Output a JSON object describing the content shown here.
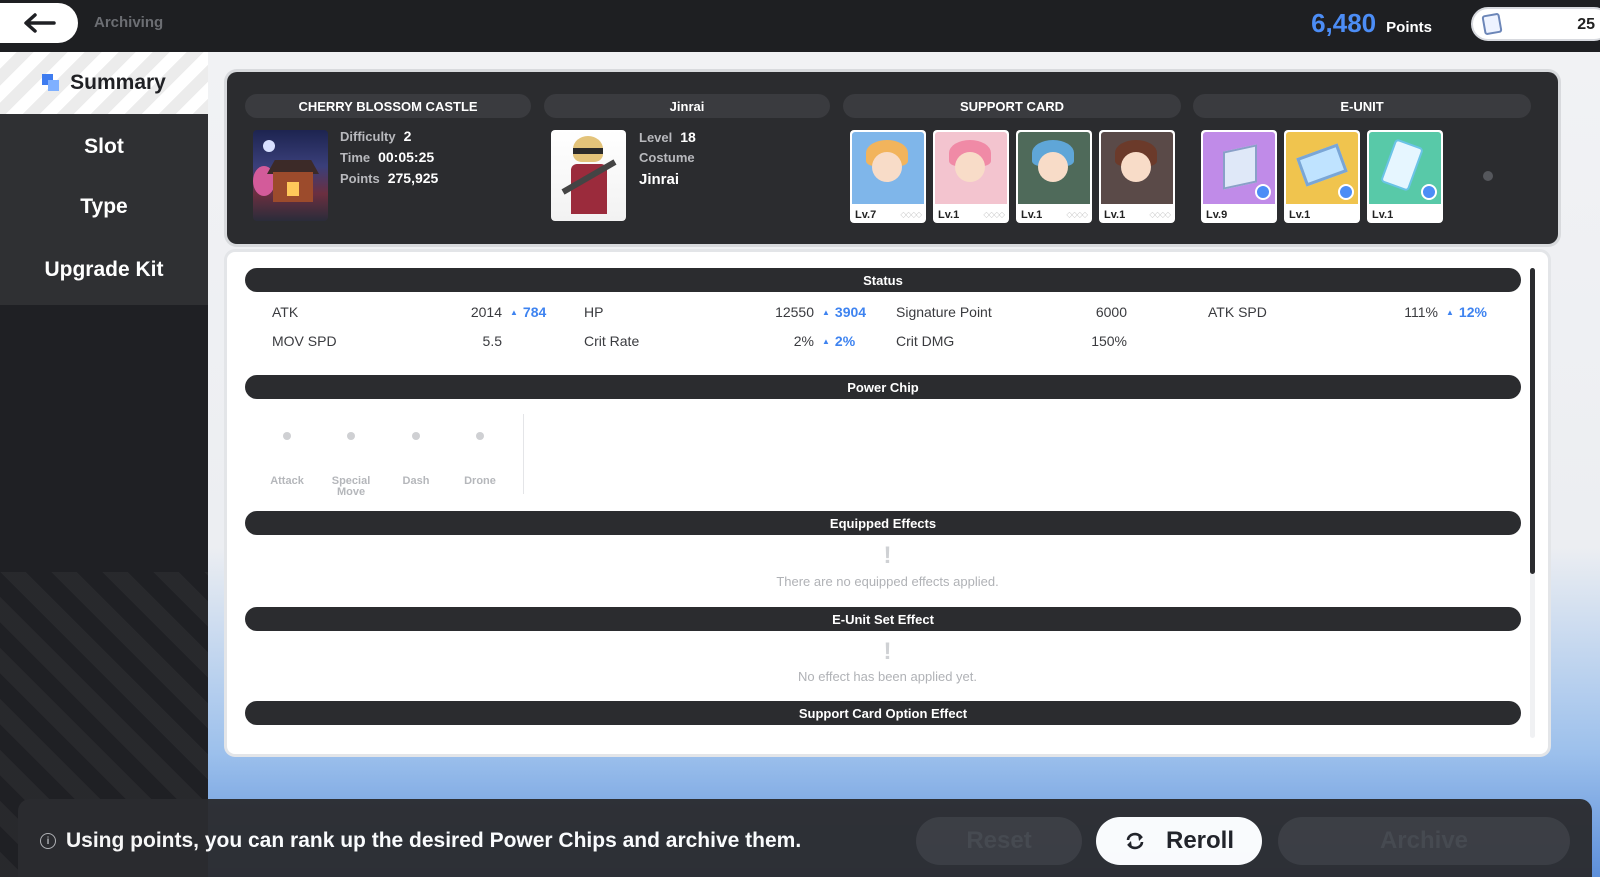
{
  "topbar": {
    "breadcrumb": "Archiving",
    "points_value": "6,480",
    "points_label": "Points",
    "currency_value": "25"
  },
  "nav": {
    "summary": "Summary",
    "slot": "Slot",
    "type": "Type",
    "upgrade_kit": "Upgrade Kit"
  },
  "header": {
    "stage_tag": "CHERRY BLOSSOM CASTLE",
    "difficulty_label": "Difficulty",
    "difficulty": "2",
    "time_label": "Time",
    "time": "00:05:25",
    "points_label": "Points",
    "points": "275,925",
    "char_tag": "Jinrai",
    "level_label": "Level",
    "level": "18",
    "costume_label": "Costume",
    "costume": "Jinrai",
    "support_tag": "SUPPORT CARD",
    "eunit_tag": "E-UNIT",
    "support_cards": [
      {
        "level": "Lv.7",
        "hair": "#f2b45c",
        "bg": "#7fb6ea"
      },
      {
        "level": "Lv.1",
        "hair": "#f08aa6",
        "bg": "#f3c4cf"
      },
      {
        "level": "Lv.1",
        "hair": "#5fa6d8",
        "bg": "#4f6a5a"
      },
      {
        "level": "Lv.1",
        "hair": "#6b3a2a",
        "bg": "#5a4a48"
      }
    ],
    "eunits": [
      {
        "level": "Lv.9",
        "bg": "#c08be8"
      },
      {
        "level": "Lv.1",
        "bg": "#f0c44e"
      },
      {
        "level": "Lv.1",
        "bg": "#58c9a8"
      }
    ]
  },
  "status": {
    "title": "Status",
    "atk_label": "ATK",
    "atk": "2014",
    "atk_inc": "784",
    "hp_label": "HP",
    "hp": "12550",
    "hp_inc": "3904",
    "sig_label": "Signature Point",
    "sig": "6000",
    "atkspd_label": "ATK SPD",
    "atkspd": "111%",
    "atkspd_inc": "12%",
    "movspd_label": "MOV SPD",
    "movspd": "5.5",
    "crit_label": "Crit Rate",
    "crit": "2%",
    "crit_inc": "2%",
    "critdmg_label": "Crit DMG",
    "critdmg": "150%"
  },
  "power_chip": {
    "title": "Power Chip",
    "slots": [
      "Attack",
      "Special Move",
      "Dash",
      "Drone"
    ]
  },
  "equipped": {
    "title": "Equipped Effects",
    "empty": "There are no equipped effects applied."
  },
  "eunit_set": {
    "title": "E-Unit Set Effect",
    "empty": "No effect has been applied yet."
  },
  "support_option": {
    "title": "Support Card Option Effect"
  },
  "bottom": {
    "info": "Using points, you can rank up the desired Power Chips and archive them.",
    "reset": "Reset",
    "reroll": "Reroll",
    "archive": "Archive"
  },
  "colors": {
    "accent": "#3e83f0",
    "dark": "#2b2c2f"
  }
}
